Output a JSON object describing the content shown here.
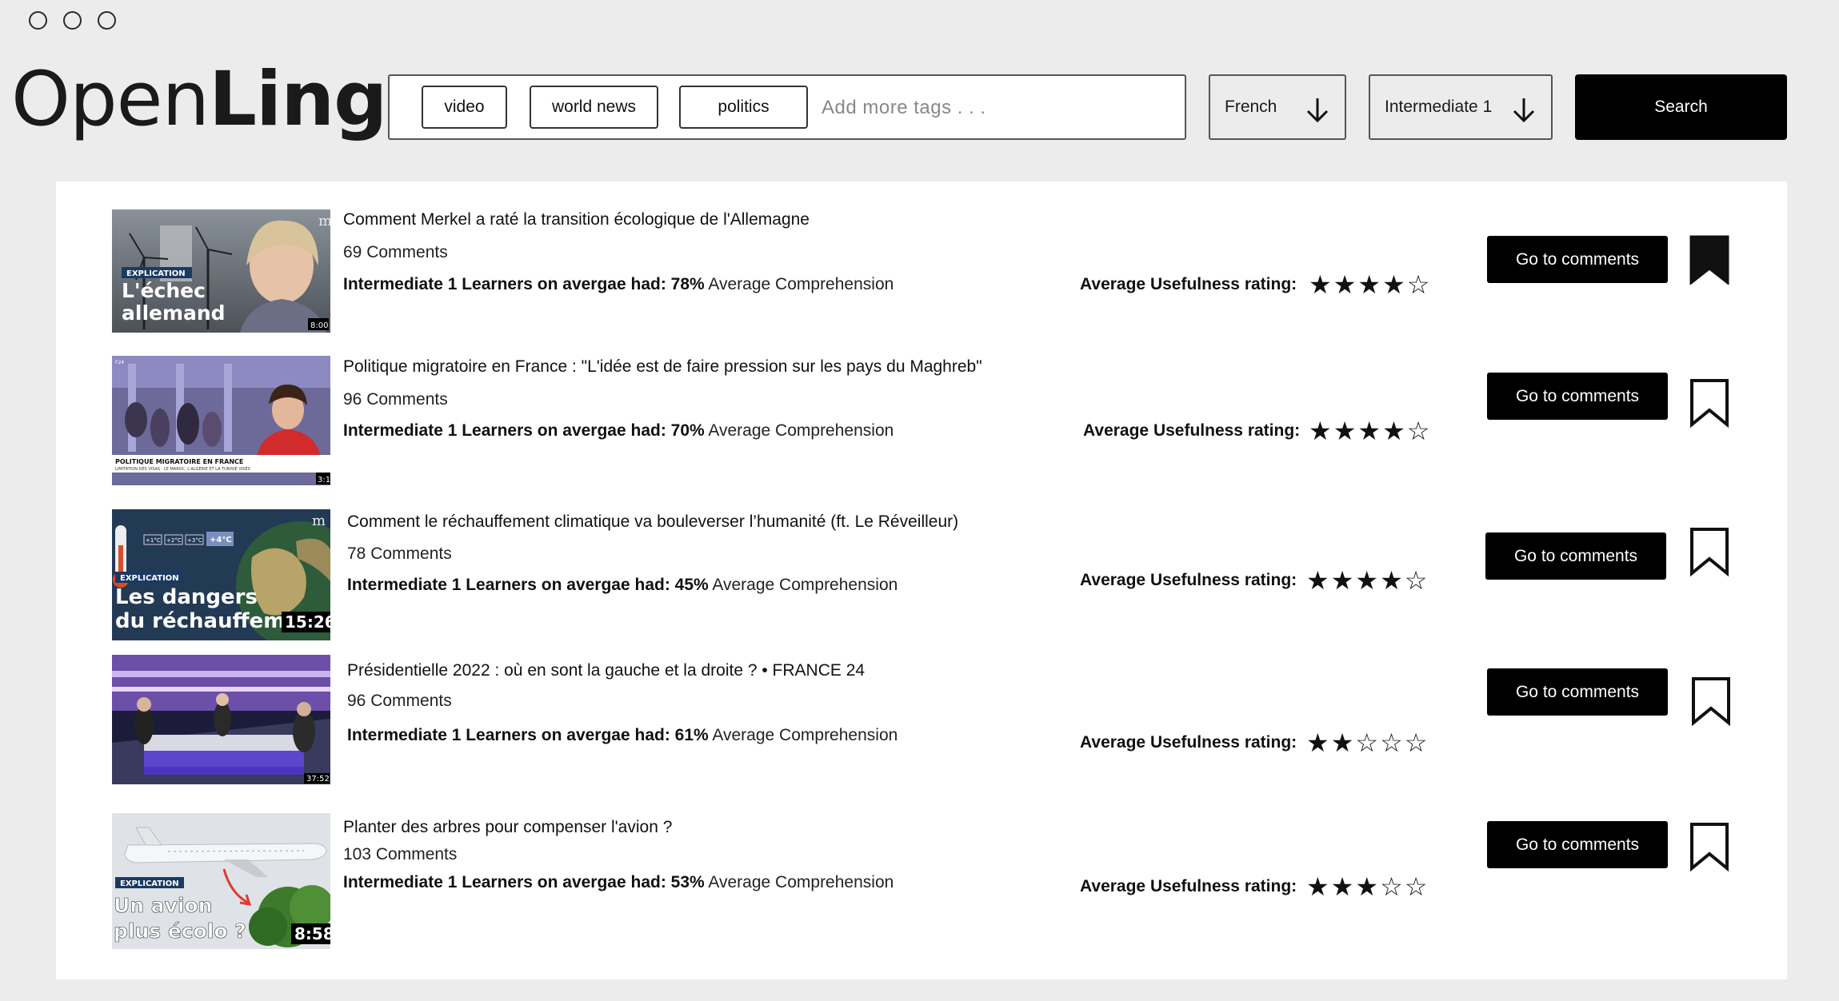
{
  "window_controls": [
    "close",
    "minimize",
    "maximize"
  ],
  "logo": {
    "part1": "Open",
    "part2": "Lingo"
  },
  "tags": [
    "video",
    "world news",
    "politics"
  ],
  "tag_placeholder": "Add more tags . . .",
  "language": {
    "value": "French",
    "icon": "arrow-down-icon"
  },
  "level": {
    "value": "Intermediate 1",
    "icon": "arrow-down-icon"
  },
  "search_label": "Search",
  "results": [
    {
      "title": "Comment Merkel a raté la transition écologique de l'Allemagne",
      "comments": "69 Comments",
      "learners_prefix": "Intermediate 1 Learners on avergae had: 78%",
      "comprehension_suffix": "Average Comprehension",
      "rating_label": "Average Usefulness rating:",
      "rating": 4,
      "stars": "★★★★☆",
      "button": "Go to comments",
      "bookmarked": true,
      "thumb": {
        "badge": "EXPLICATION",
        "caption_line1": "L'échec",
        "caption_line2": "allemand",
        "duration": "8:00",
        "corner": "m"
      }
    },
    {
      "title": "Politique migratoire en France : \"L'idée est de faire pression sur les pays du Maghreb\"",
      "comments": "96 Comments",
      "learners_prefix": "Intermediate 1 Learners on avergae had: 70%",
      "comprehension_suffix": "Average Comprehension",
      "rating_label": "Average Usefulness rating:",
      "rating": 4,
      "stars": "★★★★☆",
      "button": "Go to comments",
      "bookmarked": false,
      "thumb": {
        "banner": "POLITIQUE MIGRATOIRE EN FRANCE",
        "sub": "LIMITATION DES VISAS : LE MAROC, L'ALGÉRIE ET LA TUNISIE VISÉS",
        "duration": "3:1",
        "corner": "F24"
      }
    },
    {
      "title": "Comment le réchauffement climatique va bouleverser l’humanité (ft. Le Réveilleur)",
      "comments": "78 Comments",
      "learners_prefix": "Intermediate 1 Learners on avergae had: 45%",
      "comprehension_suffix": "Average Comprehension",
      "rating_label": "Average Usefulness rating:",
      "rating": 4,
      "stars": "★★★★☆",
      "button": "Go to comments",
      "bookmarked": false,
      "thumb": {
        "badge": "EXPLICATION",
        "caption_line1": "Les dangers",
        "caption_line2": "du réchauffem",
        "duration": "15:26",
        "temps": [
          "+1°C",
          "+2°C",
          "+3°C",
          "+4°C"
        ],
        "corner": "m"
      }
    },
    {
      "title": "Présidentielle 2022 : où en sont la gauche et la droite ? • FRANCE 24",
      "comments": "96 Comments",
      "learners_prefix": "Intermediate 1 Learners on avergae had: 61%",
      "comprehension_suffix": "Average Comprehension",
      "rating_label": "Average Usefulness rating:",
      "rating": 2,
      "stars": "★★☆☆☆",
      "button": "Go to comments",
      "bookmarked": false,
      "thumb": {
        "duration": "37:52"
      }
    },
    {
      "title": "Planter des arbres pour compenser l'avion ?",
      "comments": "103 Comments",
      "learners_prefix": "Intermediate 1 Learners on avergae had: 53%",
      "comprehension_suffix": "Average Comprehension",
      "rating_label": "Average Usefulness rating:",
      "rating": 3,
      "stars": "★★★☆☆",
      "button": "Go to comments",
      "bookmarked": false,
      "thumb": {
        "badge": "EXPLICATION",
        "caption_line1": "Un avion",
        "caption_line2": "plus écolo ?",
        "duration": "8:58"
      }
    }
  ]
}
